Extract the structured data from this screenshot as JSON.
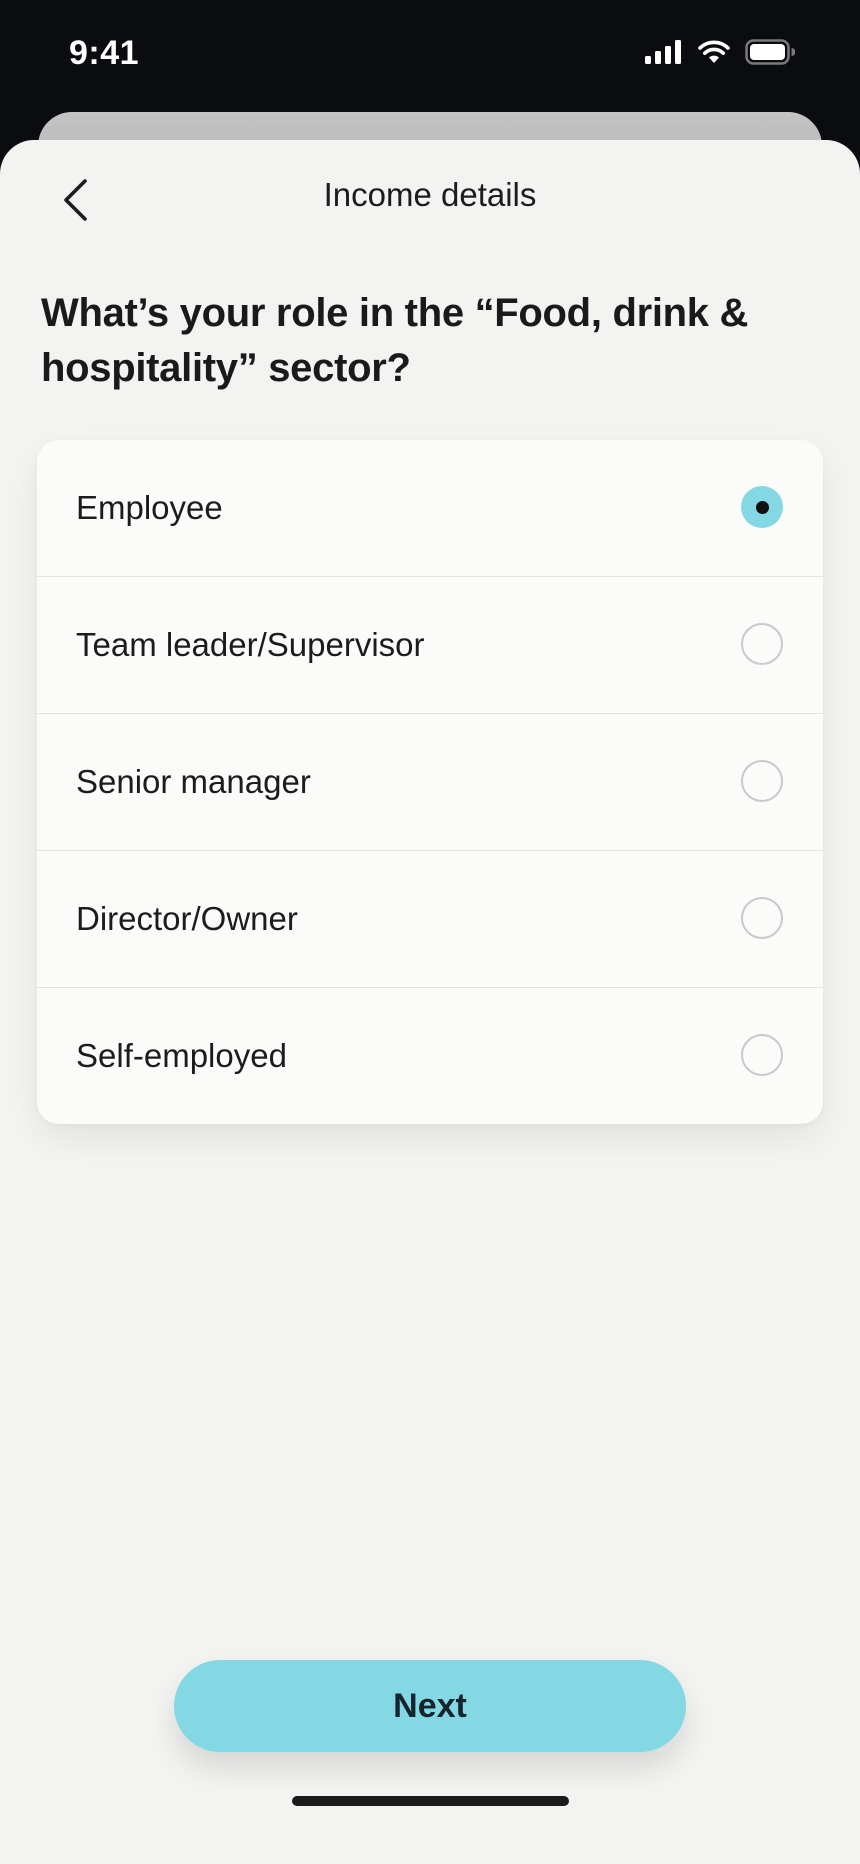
{
  "status_bar": {
    "time": "9:41"
  },
  "header": {
    "title": "Income details"
  },
  "question": "What’s your role in the “Food, drink & hospitality” sector?",
  "options": [
    {
      "label": "Employee",
      "selected": true
    },
    {
      "label": "Team leader/Supervisor",
      "selected": false
    },
    {
      "label": "Senior manager",
      "selected": false
    },
    {
      "label": "Director/Owner",
      "selected": false
    },
    {
      "label": "Self-employed",
      "selected": false
    }
  ],
  "footer": {
    "next_label": "Next"
  },
  "colors": {
    "accent": "#84d8e4",
    "background": "#f3f3f1",
    "card": "#fbfbfa"
  },
  "icons": {
    "back": "chevron-left-icon",
    "signal": "cellular-signal-icon",
    "wifi": "wifi-icon",
    "battery": "battery-icon"
  }
}
